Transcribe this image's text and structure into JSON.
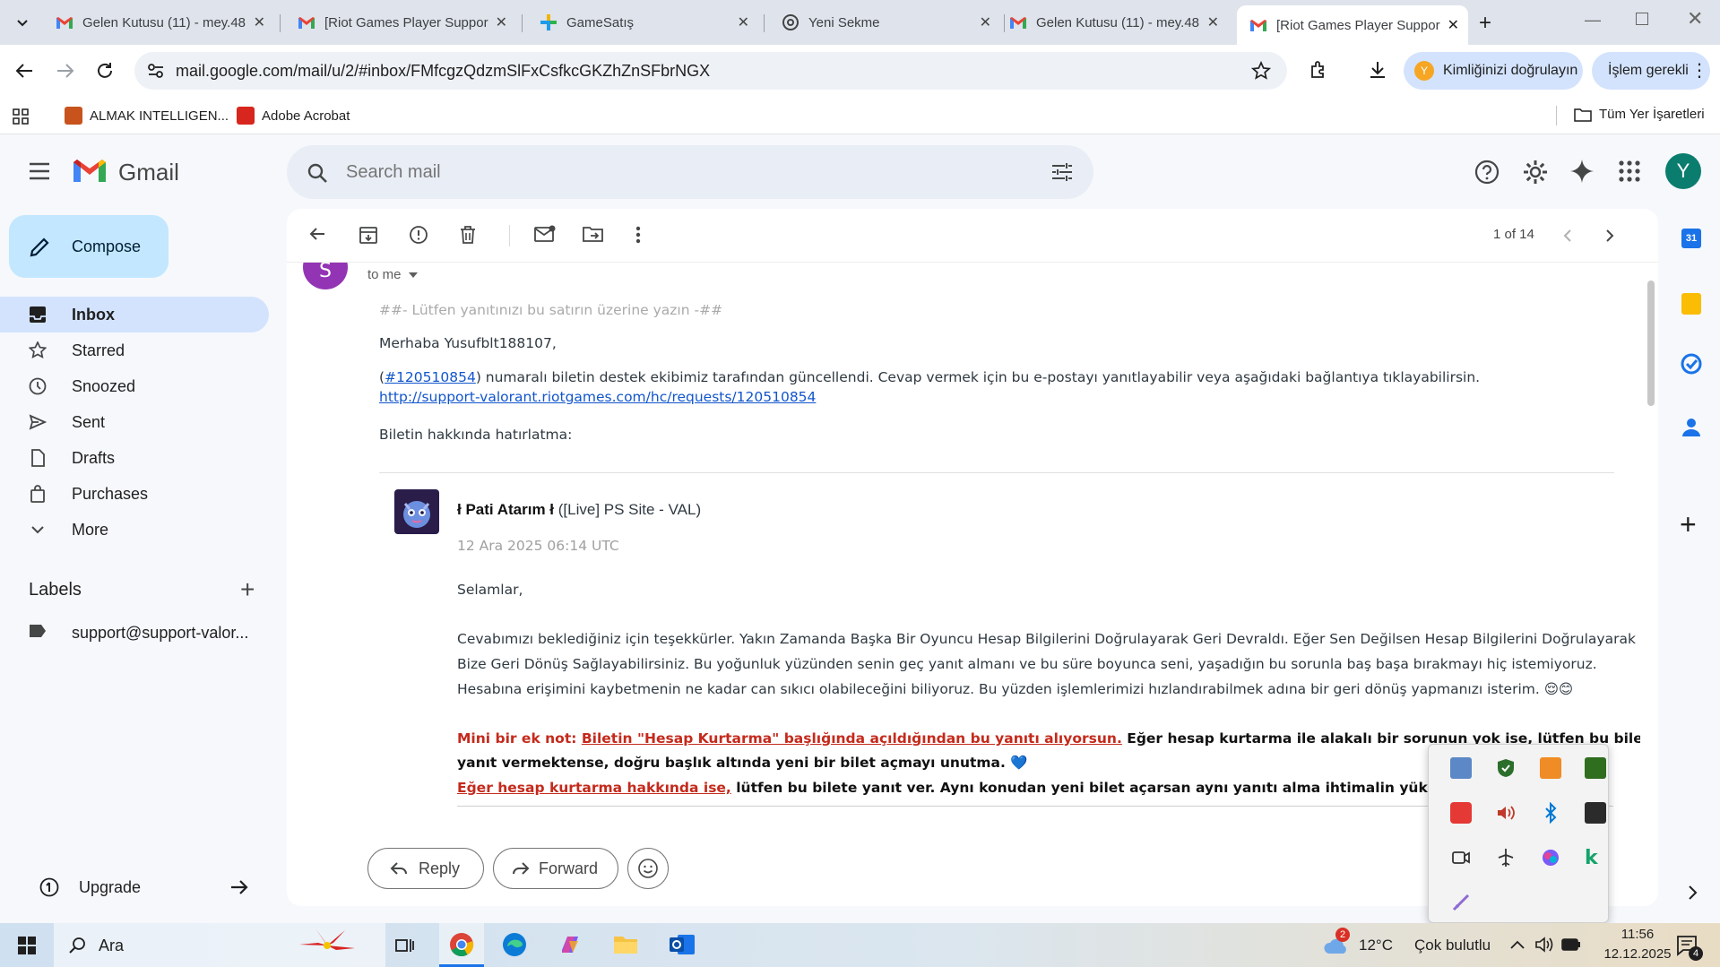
{
  "browser": {
    "tabs": [
      {
        "title": "Gelen Kutusu (11) - mey.48",
        "icon": "gmail-icon"
      },
      {
        "title": "[Riot Games Player Suppor",
        "icon": "gmail-icon"
      },
      {
        "title": "GameSatış",
        "icon": "gamesatis-icon"
      },
      {
        "title": "Yeni Sekme",
        "icon": "chrome-icon"
      },
      {
        "title": "Gelen Kutusu (11) - mey.48",
        "icon": "gmail-icon"
      },
      {
        "title": "[Riot Games Player Suppor",
        "icon": "gmail-icon"
      }
    ],
    "url": "mail.google.com/mail/u/2/#inbox/FMfcgzQdzmSlFxCsfkcGKZhZnSFbrNGX",
    "verify_label": "Kimliğinizi doğrulayın",
    "action_label": "İşlem gerekli",
    "profile_initial": "Y",
    "bookmarks": [
      {
        "label": "ALMAK INTELLIGEN..."
      },
      {
        "label": "Adobe Acrobat"
      }
    ],
    "all_bookmarks": "Tüm Yer İşaretleri"
  },
  "gmail": {
    "brand": "Gmail",
    "search_placeholder": "Search mail",
    "avatar_initial": "Y",
    "compose": "Compose",
    "nav": [
      {
        "label": "Inbox",
        "icon": "inbox-icon",
        "active": true
      },
      {
        "label": "Starred",
        "icon": "star-icon"
      },
      {
        "label": "Snoozed",
        "icon": "clock-icon"
      },
      {
        "label": "Sent",
        "icon": "send-icon"
      },
      {
        "label": "Drafts",
        "icon": "draft-icon"
      },
      {
        "label": "Purchases",
        "icon": "bag-icon"
      },
      {
        "label": "More",
        "icon": "chevron-down-icon"
      }
    ],
    "labels_title": "Labels",
    "labels": [
      "support@support-valor..."
    ],
    "upgrade": "Upgrade",
    "pager": "1 of 14"
  },
  "message": {
    "sender_initial": "S",
    "to": "to me",
    "reply_marker": "##- Lütfen yanıtınızı bu satırın üzerine yazın -##",
    "greeting": "Merhaba Yusufblt188107,",
    "ticket_open": "(",
    "ticket_link": "#120510854",
    "ticket_text": ") numaralı biletin destek ekibimiz tarafından güncellendi. Cevap vermek için bu e-postayı yanıtlayabilir veya aşağıdaki bağlantıya tıklayabilirsin.",
    "ticket_url": "http://support-valorant.riotgames.com/hc/requests/120510854",
    "reminder": "Biletin hakkında hatırlatma:",
    "agent_name": "ł Pati Atarım ł",
    "agent_role": "([Live] PS Site - VAL)",
    "date": "12 Ara 2025 06:14 UTC",
    "salutation": "Selamlar,",
    "para": [
      "Cevabımızı beklediğiniz için teşekkürler. Yakın Zamanda Başka Bir Oyuncu Hesap Bilgilerini Doğrulayarak Geri Devraldı. Eğer Sen Değilsen Hesap Bilgilerini Doğrulayarak",
      "Bize Geri Dönüş Sağlayabilirsiniz. Bu yoğunluk yüzünden senin geç yanıt almanı ve bu süre boyunca seni, yaşadığın bu sorunla baş başa bırakmayı hiç istemiyoruz.",
      "Hesabına erişimini kaybetmenin ne kadar can sıkıcı olabileceğini biliyoruz. Bu yüzden işlemlerimizi hızlandırabilmek adına bir geri dönüş yapmanızı isterim. 😌😊"
    ],
    "note_label": "Mini bir ek not: ",
    "note_link": "Biletin \"Hesap Kurtarma\" başlığında açıldığından bu yanıtı alıyorsun.",
    "note_rest": " Eğer hesap kurtarma ile alakalı bir sorunun yok ise, lütfen bu bilete",
    "note_line2": "yanıt vermektense, doğru başlık altında yeni bir bilet açmayı unutma. 💙",
    "note_line3_red": "Eğer hesap kurtarma hakkında ise,",
    "note_line3_rest": " lütfen bu bilete yanıt ver. Aynı konudan yeni bilet açarsan aynı yanıtı alma ihtimalin yüksek.",
    "reply": "Reply",
    "forward": "Forward"
  },
  "taskbar": {
    "search": "Ara",
    "weather_temp": "12°C",
    "weather_text": "Çok bulutlu",
    "weather_badge": "2",
    "time": "11:56",
    "date": "12.12.2025",
    "notif_count": "4"
  },
  "colors": {
    "gmail_red": "#ea4335",
    "gmail_blue": "#4285f4",
    "accent_link": "#1155cc",
    "warning_red": "#c42a1c",
    "sender_avatar": "#9334b5",
    "profile_avatar": "#0b7d6f"
  }
}
